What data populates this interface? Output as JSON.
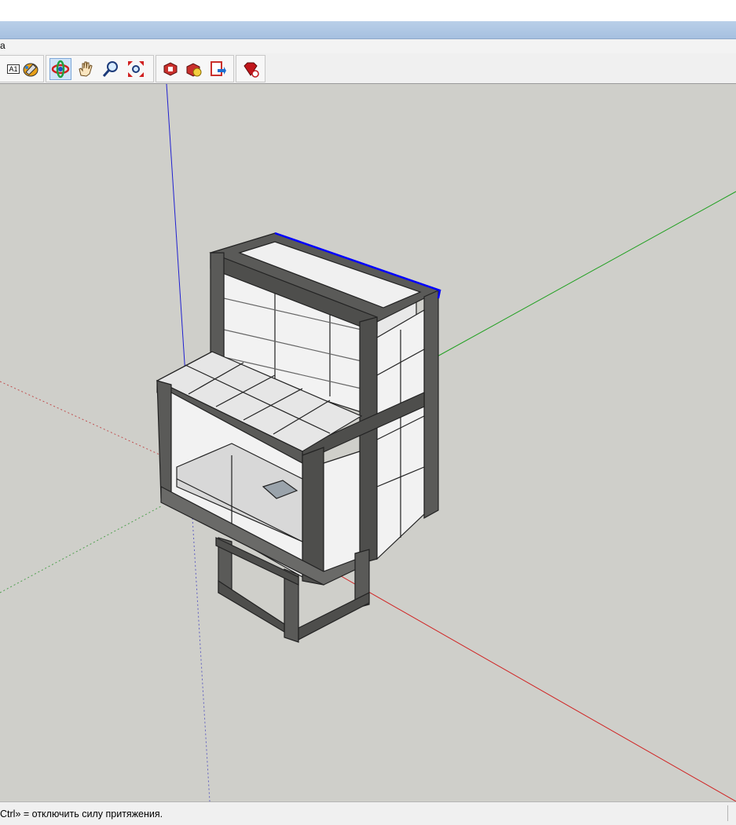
{
  "menu": {
    "partial_label": "а"
  },
  "toolbar": {
    "tools": [
      {
        "name": "text-tool",
        "label": "A1"
      },
      {
        "name": "paint-bucket"
      },
      {
        "name": "orbit"
      },
      {
        "name": "pan"
      },
      {
        "name": "zoom"
      },
      {
        "name": "zoom-extents"
      },
      {
        "name": "get-models"
      },
      {
        "name": "share-component"
      },
      {
        "name": "share-model"
      },
      {
        "name": "extension-warehouse"
      }
    ],
    "active_tool": "orbit"
  },
  "status": {
    "hint": "Ctrl» = отключить силу притяжения."
  },
  "colors": {
    "viewport_bg": "#cfcfca",
    "axis_red": "#d02020",
    "axis_green": "#20a020",
    "axis_blue": "#2020d0",
    "frame": "#5a5a58",
    "brick": "#f2f2f2",
    "selection": "#0000ff"
  }
}
